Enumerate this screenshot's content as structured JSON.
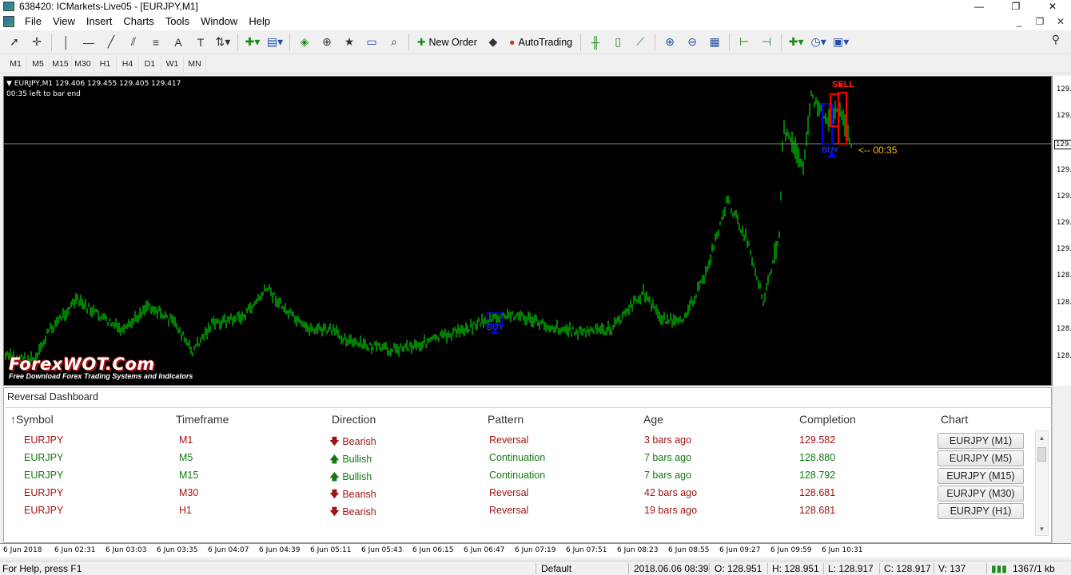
{
  "window": {
    "title": "638420: ICMarkets-Live05 - [EURJPY,M1]",
    "controls": [
      "—",
      "❐",
      "✕"
    ]
  },
  "menu": [
    "File",
    "View",
    "Insert",
    "Charts",
    "Tools",
    "Window",
    "Help"
  ],
  "mdi_controls": [
    "_",
    "❐",
    "✕"
  ],
  "toolbar": {
    "new_order": "New Order",
    "auto_trading": "AutoTrading"
  },
  "timeframes": [
    "M1",
    "M5",
    "M15",
    "M30",
    "H1",
    "H4",
    "D1",
    "W1",
    "MN"
  ],
  "chart": {
    "symbol_line": "EURJPY,M1  129.406 129.455 129.405 129.417",
    "countdown_info": "00:35 left to bar end",
    "countdown_label": "<-- 00:35",
    "price_labels": [
      "129.",
      "129.",
      "129.",
      "129.",
      "129.",
      "129.",
      "129.",
      "128.",
      "128.",
      "128.",
      "128.",
      "128."
    ],
    "current_price_label": "129.",
    "sell_label": "SELL",
    "buy_label": "BUY",
    "time_labels": [
      "6 Jun 2018",
      "6 Jun 02:31",
      "6 Jun 03:03",
      "6 Jun 03:35",
      "6 Jun 04:07",
      "6 Jun 04:39",
      "6 Jun 05:11",
      "6 Jun 05:43",
      "6 Jun 06:15",
      "6 Jun 06:47",
      "6 Jun 07:19",
      "6 Jun 07:51",
      "6 Jun 08:23",
      "6 Jun 08:55",
      "6 Jun 09:27",
      "6 Jun 09:59",
      "6 Jun 10:31"
    ],
    "colors": {
      "bars": "#00ff00",
      "buy": "#0000ff",
      "sell": "#ff0000",
      "countdown": "#ffc000"
    }
  },
  "watermark": {
    "brand": "ForexWOT.Com",
    "tagline": "Free Download Forex Trading Systems and Indicators"
  },
  "dashboard": {
    "title": "Reversal Dashboard",
    "columns": [
      "↑Symbol",
      "Timeframe",
      "Direction",
      "Pattern",
      "Age",
      "Completion",
      "Chart"
    ],
    "rows": [
      {
        "symbol": "EURJPY",
        "timeframe": "M1",
        "arrow": "🡇",
        "direction": "Bearish",
        "pattern": "Reversal",
        "age": "3 bars ago",
        "completion": "129.582",
        "chart_button": "EURJPY (M1)",
        "bull": false
      },
      {
        "symbol": "EURJPY",
        "timeframe": "M5",
        "arrow": "🡅",
        "direction": "Bullish",
        "pattern": "Continuation",
        "age": "7 bars ago",
        "completion": "128.880",
        "chart_button": "EURJPY (M5)",
        "bull": true
      },
      {
        "symbol": "EURJPY",
        "timeframe": "M15",
        "arrow": "🡅",
        "direction": "Bullish",
        "pattern": "Continuation",
        "age": "7 bars ago",
        "completion": "128.792",
        "chart_button": "EURJPY (M15)",
        "bull": true
      },
      {
        "symbol": "EURJPY",
        "timeframe": "M30",
        "arrow": "🡇",
        "direction": "Bearish",
        "pattern": "Reversal",
        "age": "42 bars ago",
        "completion": "128.681",
        "chart_button": "EURJPY (M30)",
        "bull": false
      },
      {
        "symbol": "EURJPY",
        "timeframe": "H1",
        "arrow": "🡇",
        "direction": "Bearish",
        "pattern": "Reversal",
        "age": "19 bars ago",
        "completion": "128.681",
        "chart_button": "EURJPY (H1)",
        "bull": false
      }
    ]
  },
  "status": {
    "help": "For Help, press F1",
    "profile": "Default",
    "datetime": "2018.06.06 08:39",
    "open": "O: 128.951",
    "high": "H: 128.951",
    "low": "L: 128.917",
    "close": "C: 128.917",
    "volume": "V: 137",
    "traffic": "1367/1 kb"
  }
}
